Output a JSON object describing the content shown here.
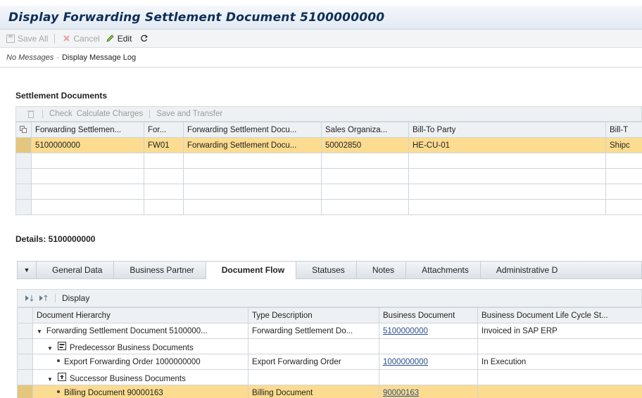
{
  "window": {
    "title": "Display Forwarding Settlement Document 5100000000"
  },
  "toolbar": {
    "save_all": "Save All",
    "cancel": "Cancel",
    "edit": "Edit"
  },
  "messages": {
    "status": "No Messages",
    "log_link": "Display Message Log"
  },
  "settlement": {
    "title": "Settlement Documents",
    "actions": {
      "check": "Check",
      "calculate": "Calculate Charges",
      "save_transfer": "Save and Transfer"
    },
    "columns": [
      "Forwarding Settlemen...",
      "For...",
      "Forwarding Settlement Docu...",
      "Sales Organiza...",
      "Bill-To Party",
      "Bill-T"
    ],
    "rows": [
      [
        "5100000000",
        "FW01",
        "Forwarding Settlement Docu...",
        "50002850",
        "HE-CU-01",
        "Shipc"
      ]
    ]
  },
  "details": {
    "title": "Details: 5100000000",
    "tabs": [
      "General Data",
      "Business Partner",
      "Document Flow",
      "Statuses",
      "Notes",
      "Attachments",
      "Administrative D"
    ],
    "active_tab": "Document Flow",
    "flow_toolbar": {
      "display": "Display"
    },
    "columns": [
      "Document Hierarchy",
      "Type Description",
      "Business Document",
      "Business Document Life Cycle St..."
    ],
    "rows": [
      {
        "hierarchy": "Forwarding Settlement Document 5100000...",
        "type": "Forwarding Settlement Do...",
        "doc": "5100000000",
        "status": "Invoiced in SAP ERP"
      },
      {
        "hierarchy": "Predecessor Business Documents",
        "type": "",
        "doc": "",
        "status": ""
      },
      {
        "hierarchy": "Export Forwarding Order 1000000000",
        "type": "Export Forwarding Order",
        "doc": "1000000000",
        "status": "In Execution"
      },
      {
        "hierarchy": "Successor Business Documents",
        "type": "",
        "doc": "",
        "status": ""
      },
      {
        "hierarchy": "Billing Document 90000163",
        "type": "Billing Document",
        "doc": "90000163",
        "status": ""
      }
    ]
  },
  "colors": {
    "title": "#0d2f58",
    "selection": "#fbdc90",
    "link": "#2b4f8c"
  }
}
